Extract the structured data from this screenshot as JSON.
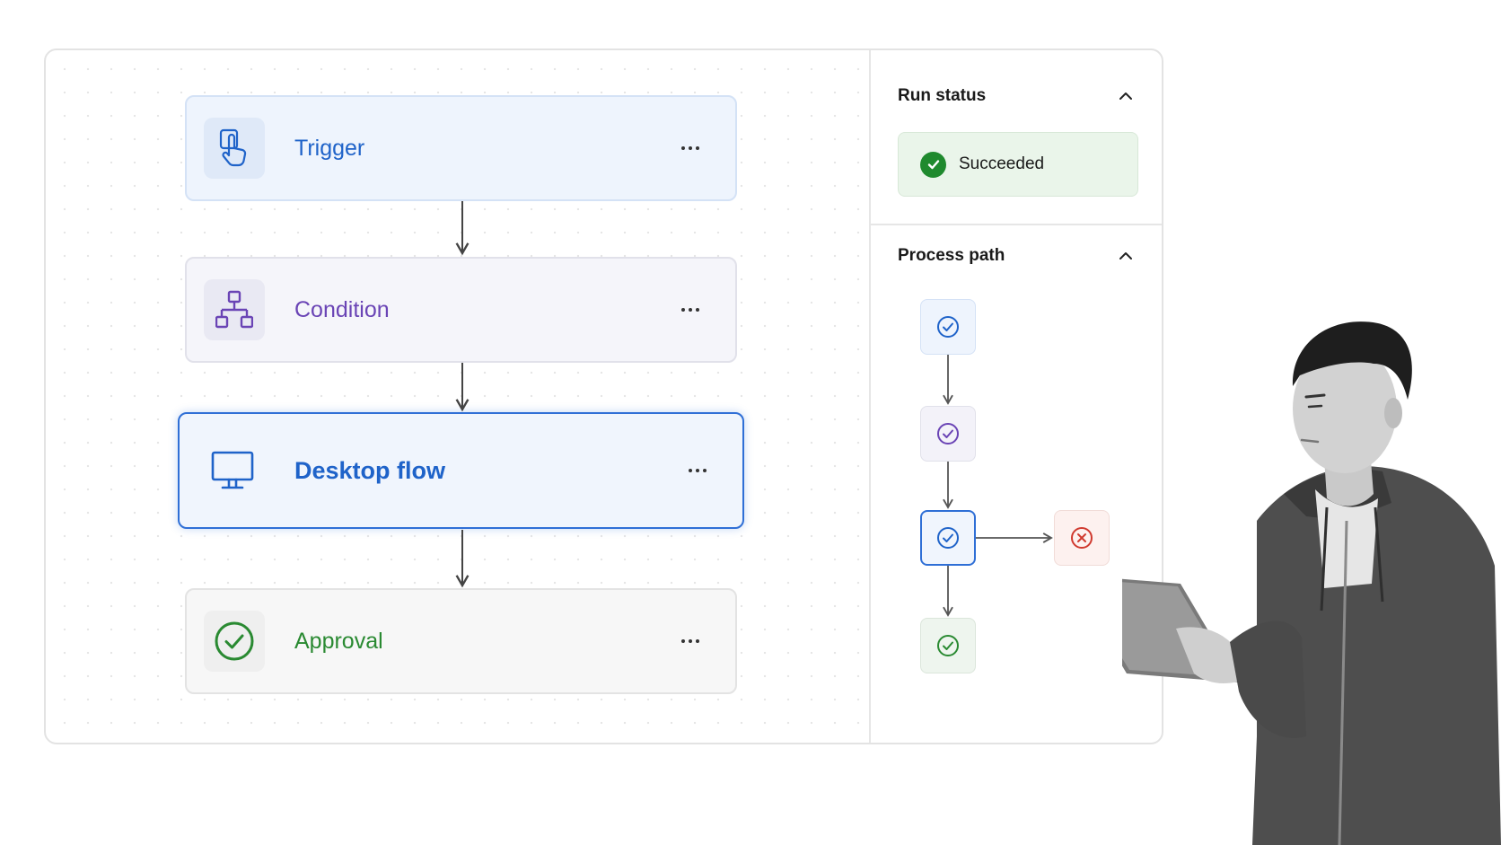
{
  "flow": {
    "nodes": [
      {
        "label": "Trigger",
        "icon": "touch-hand-icon",
        "color": "#1f63c9"
      },
      {
        "label": "Condition",
        "icon": "branch-icon",
        "color": "#6a44b5"
      },
      {
        "label": "Desktop flow",
        "icon": "monitor-icon",
        "color": "#1f63c9",
        "selected": true
      },
      {
        "label": "Approval",
        "icon": "check-circle-icon",
        "color": "#2a8a32"
      }
    ],
    "more_icon": "more-horizontal-icon"
  },
  "panel": {
    "run_status": {
      "title": "Run status",
      "status": "Succeeded",
      "status_color": "#1f8a2e"
    },
    "process_path": {
      "title": "Process path",
      "steps": [
        {
          "state": "success",
          "color": "#1f63c9"
        },
        {
          "state": "success",
          "color": "#6a44b5"
        },
        {
          "state": "success",
          "color": "#1f63c9",
          "active": true
        },
        {
          "state": "success",
          "color": "#2a8a32"
        },
        {
          "state": "error",
          "color": "#d03a2f",
          "branch_of": 3
        }
      ]
    }
  },
  "illustration": {
    "subject": "person-holding-tablet"
  }
}
